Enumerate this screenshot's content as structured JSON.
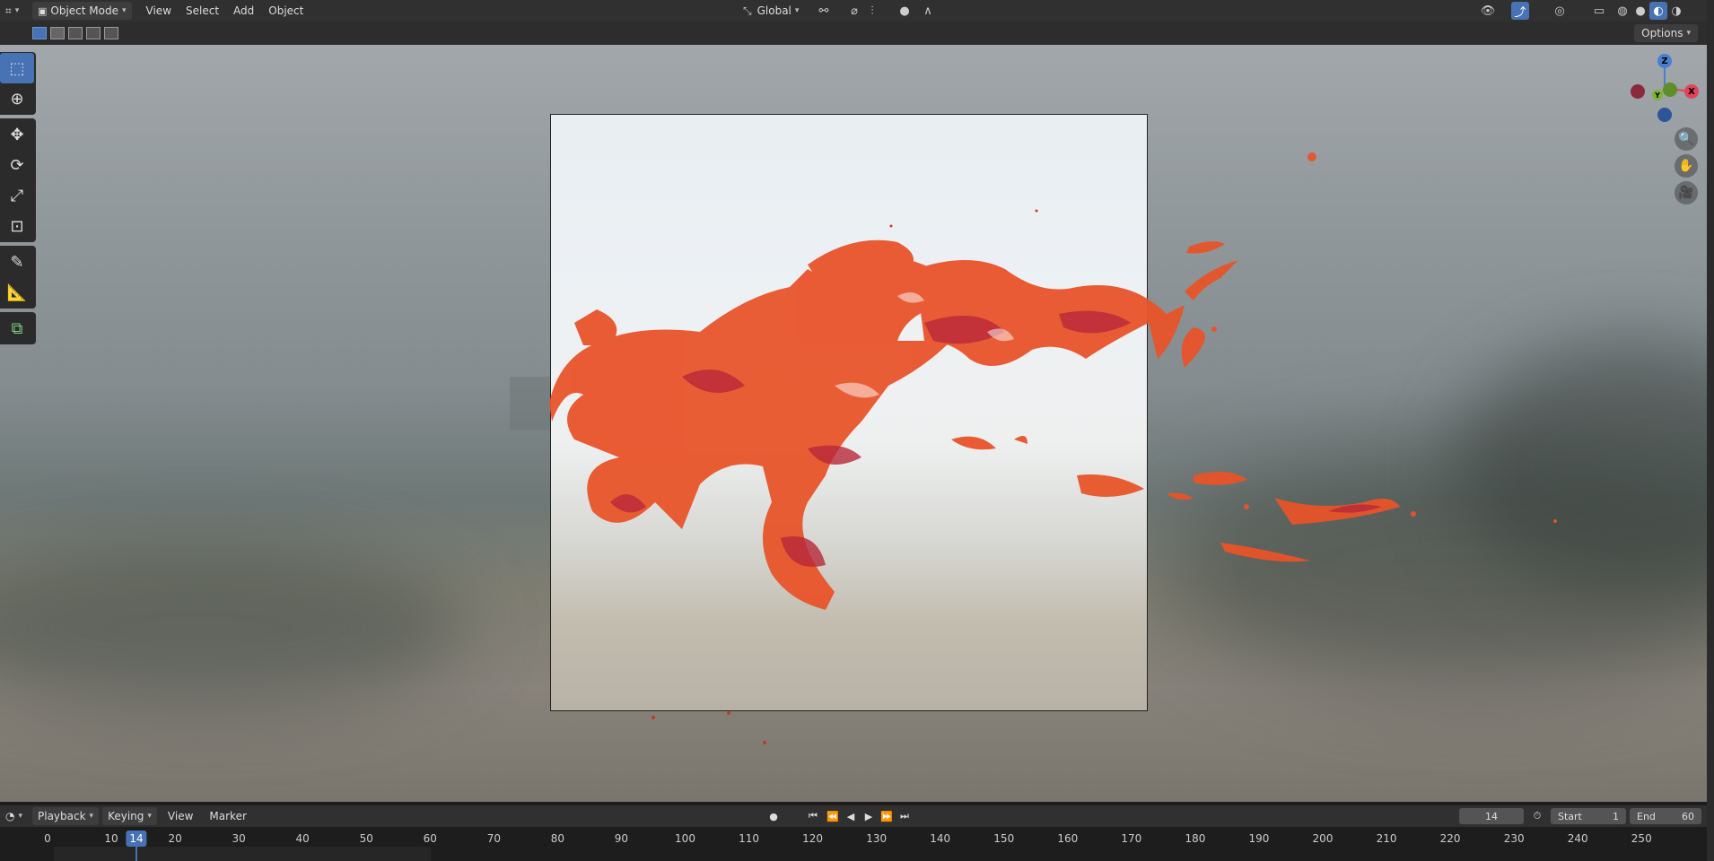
{
  "header": {
    "editor_icon": "editor-type-icon",
    "mode": "Object Mode",
    "menus": [
      "View",
      "Select",
      "Add",
      "Object"
    ],
    "transform_orientation": "Global"
  },
  "toolheader": {
    "options_label": "Options"
  },
  "toolbar": {
    "tools": [
      "select-box-icon",
      "cursor-icon",
      "move-icon",
      "rotate-icon",
      "scale-icon",
      "transform-icon",
      "annotate-icon",
      "measure-icon",
      "add-cube-icon"
    ]
  },
  "gizmo": {
    "z": "Z",
    "x": "X",
    "y": "Y"
  },
  "timeline": {
    "menus": [
      "Playback",
      "Keying",
      "View",
      "Marker"
    ],
    "current_frame": "14",
    "start_label": "Start",
    "start_value": "1",
    "end_label": "End",
    "end_value": "60",
    "ticks": [
      "0",
      "10",
      "20",
      "30",
      "40",
      "50",
      "60",
      "70",
      "80",
      "90",
      "100",
      "110",
      "120",
      "130",
      "140",
      "150",
      "160",
      "170",
      "180",
      "190",
      "200",
      "210",
      "220",
      "230",
      "240",
      "250"
    ]
  },
  "colors": {
    "accent": "#4772b3",
    "fluid": "#e8542a",
    "fluid_dark": "#b8283a"
  }
}
